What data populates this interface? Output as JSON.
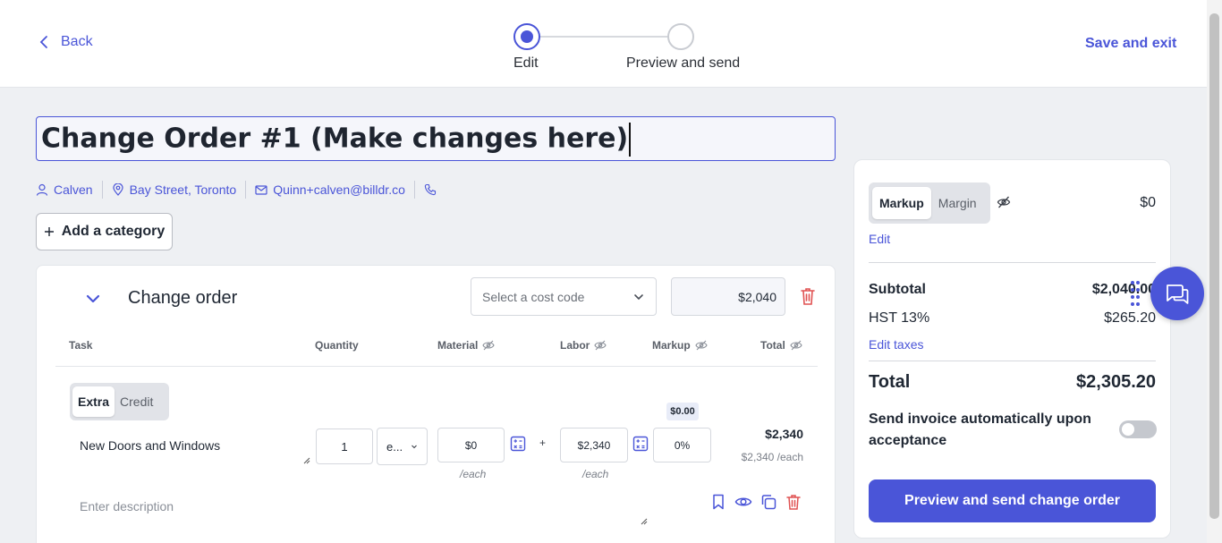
{
  "header": {
    "back_label": "Back",
    "save_exit_label": "Save and exit",
    "steps": [
      {
        "label": "Edit",
        "state": "active"
      },
      {
        "label": "Preview and send",
        "state": "inactive"
      }
    ]
  },
  "document": {
    "title": "Change Order #1 (Make changes here)",
    "contact": {
      "name": "Calven",
      "address": "Bay Street, Toronto",
      "email": "Quinn+calven@billdr.co"
    },
    "add_category_label": "Add a category"
  },
  "category": {
    "title": "Change order",
    "cost_code_placeholder": "Select a cost code",
    "amount": "$2,040",
    "columns": {
      "task": "Task",
      "quantity": "Quantity",
      "material": "Material",
      "labor": "Labor",
      "markup": "Markup",
      "total": "Total"
    },
    "item": {
      "type_options": [
        "Extra",
        "Credit"
      ],
      "selected_type": "Extra",
      "name": "New Doors and Windows",
      "quantity": "1",
      "unit": "e...",
      "material": "$0",
      "material_each": "/each",
      "plus": "+",
      "labor": "$2,340",
      "labor_each": "/each",
      "markup_amount": "$0.00",
      "markup_percent": "0%",
      "total": "$2,340",
      "total_each": "$2,340 /each",
      "description_placeholder": "Enter description"
    }
  },
  "summary": {
    "markup_options": [
      "Markup",
      "Margin"
    ],
    "selected_markup": "Markup",
    "markup_value": "$0",
    "edit_label": "Edit",
    "subtotal_label": "Subtotal",
    "subtotal_value": "$2,040.00",
    "tax_label": "HST 13%",
    "tax_value": "$265.20",
    "edit_taxes_label": "Edit taxes",
    "total_label": "Total",
    "total_value": "$2,305.20",
    "send_auto_label": "Send invoice automatically upon acceptance",
    "send_auto_enabled": false,
    "preview_button_label": "Preview and send change order"
  },
  "colors": {
    "accent": "#4a55d8",
    "danger": "#e05252",
    "background": "#eef0f3"
  },
  "icons": [
    "chevron-left-icon",
    "user-icon",
    "location-pin-icon",
    "mail-icon",
    "phone-icon",
    "plus-icon",
    "chevron-down-icon",
    "trash-icon",
    "eye-off-icon",
    "calculator-icon",
    "bookmark-icon",
    "eye-icon",
    "copy-icon",
    "chat-icon"
  ]
}
